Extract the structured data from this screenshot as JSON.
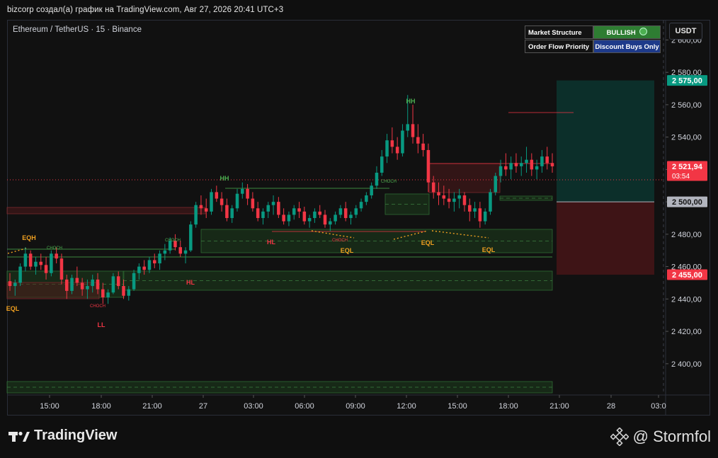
{
  "header": {
    "title": "bizcorp создал(а) график на TradingView.com, Авг 27, 2026 20:41 UTC+3"
  },
  "symbol": {
    "label": "Ethereum / TetherUS · 15 · Binance"
  },
  "currency": "USDT",
  "panel": {
    "row1_label": "Market Structure",
    "row1_value": "BULLISH",
    "row2_label": "Order Flow Priority",
    "row2_value": "Discount Buys Only",
    "colors": {
      "bullish_bg": "#2e7d32",
      "discount_bg": "#1e3a8a"
    }
  },
  "price_axis": {
    "ticks": [
      "2 600,00",
      "2 580,00",
      "2 560,00",
      "2 540,00",
      "2 520,00",
      "2 500,00",
      "2 480,00",
      "2 460,00",
      "2 440,00",
      "2 420,00",
      "2 400,00"
    ],
    "markers": [
      {
        "label": "2 575,00",
        "color": "#089981"
      },
      {
        "label": "2 521,94",
        "sub": "03:54",
        "color": "#f23645"
      },
      {
        "label": "2 500,00",
        "color": "#b2b5be"
      },
      {
        "label": "2 455,00",
        "color": "#f23645"
      }
    ]
  },
  "time_axis": {
    "ticks": [
      "15:00",
      "18:00",
      "21:00",
      "27",
      "03:00",
      "06:00",
      "09:00",
      "12:00",
      "15:00",
      "18:00",
      "21:00",
      "28",
      "03:0"
    ]
  },
  "annotations": {
    "hh1": "HH",
    "hh2": "HH",
    "ll": "LL",
    "hl1": "HL",
    "hl2": "HL",
    "eqh": "EQH",
    "eql1": "EQL",
    "eql2": "EQL",
    "eql3": "EQL",
    "eql4": "EQL",
    "choch": "CHOCH"
  },
  "footer": {
    "brand": "TradingView",
    "author": "@ Stormfol"
  },
  "chart_data": {
    "type": "candlestick",
    "title": "Ethereum / TetherUS · 15 · Binance",
    "ylim": [
      2382,
      2612
    ],
    "last_price": 2521.94,
    "position": {
      "entry": 2500.0,
      "target": 2575.0,
      "stop": 2455.0
    },
    "ohlc": [
      [
        2451,
        2456,
        2445,
        2448
      ],
      [
        2448,
        2452,
        2442,
        2450
      ],
      [
        2450,
        2462,
        2448,
        2460
      ],
      [
        2460,
        2472,
        2457,
        2468
      ],
      [
        2468,
        2470,
        2458,
        2460
      ],
      [
        2460,
        2466,
        2455,
        2463
      ],
      [
        2463,
        2468,
        2458,
        2461
      ],
      [
        2461,
        2466,
        2452,
        2456
      ],
      [
        2456,
        2470,
        2454,
        2468
      ],
      [
        2468,
        2472,
        2462,
        2465
      ],
      [
        2465,
        2468,
        2449,
        2452
      ],
      [
        2452,
        2455,
        2440,
        2445
      ],
      [
        2445,
        2455,
        2443,
        2453
      ],
      [
        2453,
        2460,
        2448,
        2450
      ],
      [
        2450,
        2453,
        2442,
        2446
      ],
      [
        2446,
        2452,
        2440,
        2448
      ],
      [
        2448,
        2455,
        2444,
        2452
      ],
      [
        2452,
        2456,
        2443,
        2446
      ],
      [
        2446,
        2450,
        2437,
        2441
      ],
      [
        2441,
        2446,
        2437,
        2444
      ],
      [
        2444,
        2456,
        2443,
        2454
      ],
      [
        2454,
        2457,
        2446,
        2448
      ],
      [
        2448,
        2452,
        2440,
        2442
      ],
      [
        2442,
        2448,
        2439,
        2446
      ],
      [
        2446,
        2458,
        2445,
        2456
      ],
      [
        2456,
        2462,
        2452,
        2460
      ],
      [
        2460,
        2464,
        2455,
        2458
      ],
      [
        2458,
        2466,
        2456,
        2464
      ],
      [
        2464,
        2468,
        2459,
        2462
      ],
      [
        2462,
        2470,
        2458,
        2468
      ],
      [
        2468,
        2474,
        2464,
        2470
      ],
      [
        2470,
        2478,
        2468,
        2476
      ],
      [
        2476,
        2480,
        2470,
        2472
      ],
      [
        2472,
        2476,
        2466,
        2468
      ],
      [
        2468,
        2472,
        2462,
        2470
      ],
      [
        2470,
        2488,
        2469,
        2486
      ],
      [
        2486,
        2500,
        2484,
        2498
      ],
      [
        2498,
        2504,
        2492,
        2496
      ],
      [
        2496,
        2502,
        2490,
        2494
      ],
      [
        2494,
        2508,
        2492,
        2506
      ],
      [
        2506,
        2510,
        2500,
        2502
      ],
      [
        2502,
        2506,
        2494,
        2498
      ],
      [
        2498,
        2502,
        2488,
        2490
      ],
      [
        2490,
        2498,
        2487,
        2496
      ],
      [
        2496,
        2508,
        2494,
        2505
      ],
      [
        2505,
        2512,
        2502,
        2508
      ],
      [
        2508,
        2511,
        2498,
        2502
      ],
      [
        2502,
        2506,
        2494,
        2496
      ],
      [
        2496,
        2500,
        2488,
        2490
      ],
      [
        2490,
        2496,
        2486,
        2494
      ],
      [
        2494,
        2500,
        2490,
        2498
      ],
      [
        2498,
        2504,
        2492,
        2500
      ],
      [
        2500,
        2503,
        2490,
        2492
      ],
      [
        2492,
        2496,
        2486,
        2488
      ],
      [
        2488,
        2494,
        2485,
        2492
      ],
      [
        2492,
        2498,
        2489,
        2496
      ],
      [
        2496,
        2500,
        2490,
        2494
      ],
      [
        2494,
        2497,
        2486,
        2488
      ],
      [
        2488,
        2492,
        2484,
        2490
      ],
      [
        2490,
        2496,
        2487,
        2494
      ],
      [
        2494,
        2498,
        2490,
        2492
      ],
      [
        2492,
        2495,
        2484,
        2486
      ],
      [
        2486,
        2490,
        2482,
        2488
      ],
      [
        2488,
        2494,
        2486,
        2492
      ],
      [
        2492,
        2498,
        2490,
        2496
      ],
      [
        2496,
        2500,
        2488,
        2490
      ],
      [
        2490,
        2494,
        2486,
        2492
      ],
      [
        2492,
        2498,
        2490,
        2496
      ],
      [
        2496,
        2502,
        2494,
        2500
      ],
      [
        2500,
        2506,
        2498,
        2504
      ],
      [
        2504,
        2512,
        2502,
        2510
      ],
      [
        2510,
        2522,
        2508,
        2518
      ],
      [
        2518,
        2532,
        2516,
        2528
      ],
      [
        2528,
        2542,
        2524,
        2538
      ],
      [
        2538,
        2546,
        2530,
        2534
      ],
      [
        2534,
        2540,
        2526,
        2530
      ],
      [
        2530,
        2548,
        2528,
        2544
      ],
      [
        2544,
        2566,
        2540,
        2548
      ],
      [
        2548,
        2560,
        2536,
        2540
      ],
      [
        2540,
        2548,
        2530,
        2536
      ],
      [
        2536,
        2542,
        2528,
        2532
      ],
      [
        2532,
        2536,
        2506,
        2512
      ],
      [
        2512,
        2516,
        2502,
        2506
      ],
      [
        2506,
        2512,
        2498,
        2504
      ],
      [
        2504,
        2510,
        2498,
        2502
      ],
      [
        2502,
        2508,
        2496,
        2500
      ],
      [
        2500,
        2506,
        2494,
        2502
      ],
      [
        2502,
        2508,
        2496,
        2504
      ],
      [
        2504,
        2506,
        2494,
        2498
      ],
      [
        2498,
        2502,
        2488,
        2494
      ],
      [
        2494,
        2500,
        2490,
        2496
      ],
      [
        2496,
        2500,
        2484,
        2488
      ],
      [
        2488,
        2496,
        2486,
        2494
      ],
      [
        2494,
        2508,
        2492,
        2506
      ],
      [
        2506,
        2518,
        2504,
        2516
      ],
      [
        2516,
        2526,
        2512,
        2522
      ],
      [
        2522,
        2530,
        2516,
        2520
      ],
      [
        2520,
        2528,
        2514,
        2524
      ],
      [
        2524,
        2530,
        2518,
        2522
      ],
      [
        2522,
        2528,
        2516,
        2524
      ],
      [
        2524,
        2534,
        2518,
        2526
      ],
      [
        2526,
        2530,
        2516,
        2520
      ],
      [
        2520,
        2526,
        2514,
        2522
      ],
      [
        2522,
        2532,
        2518,
        2528
      ],
      [
        2528,
        2534,
        2520,
        2524
      ],
      [
        2524,
        2530,
        2518,
        2521.94
      ]
    ]
  }
}
